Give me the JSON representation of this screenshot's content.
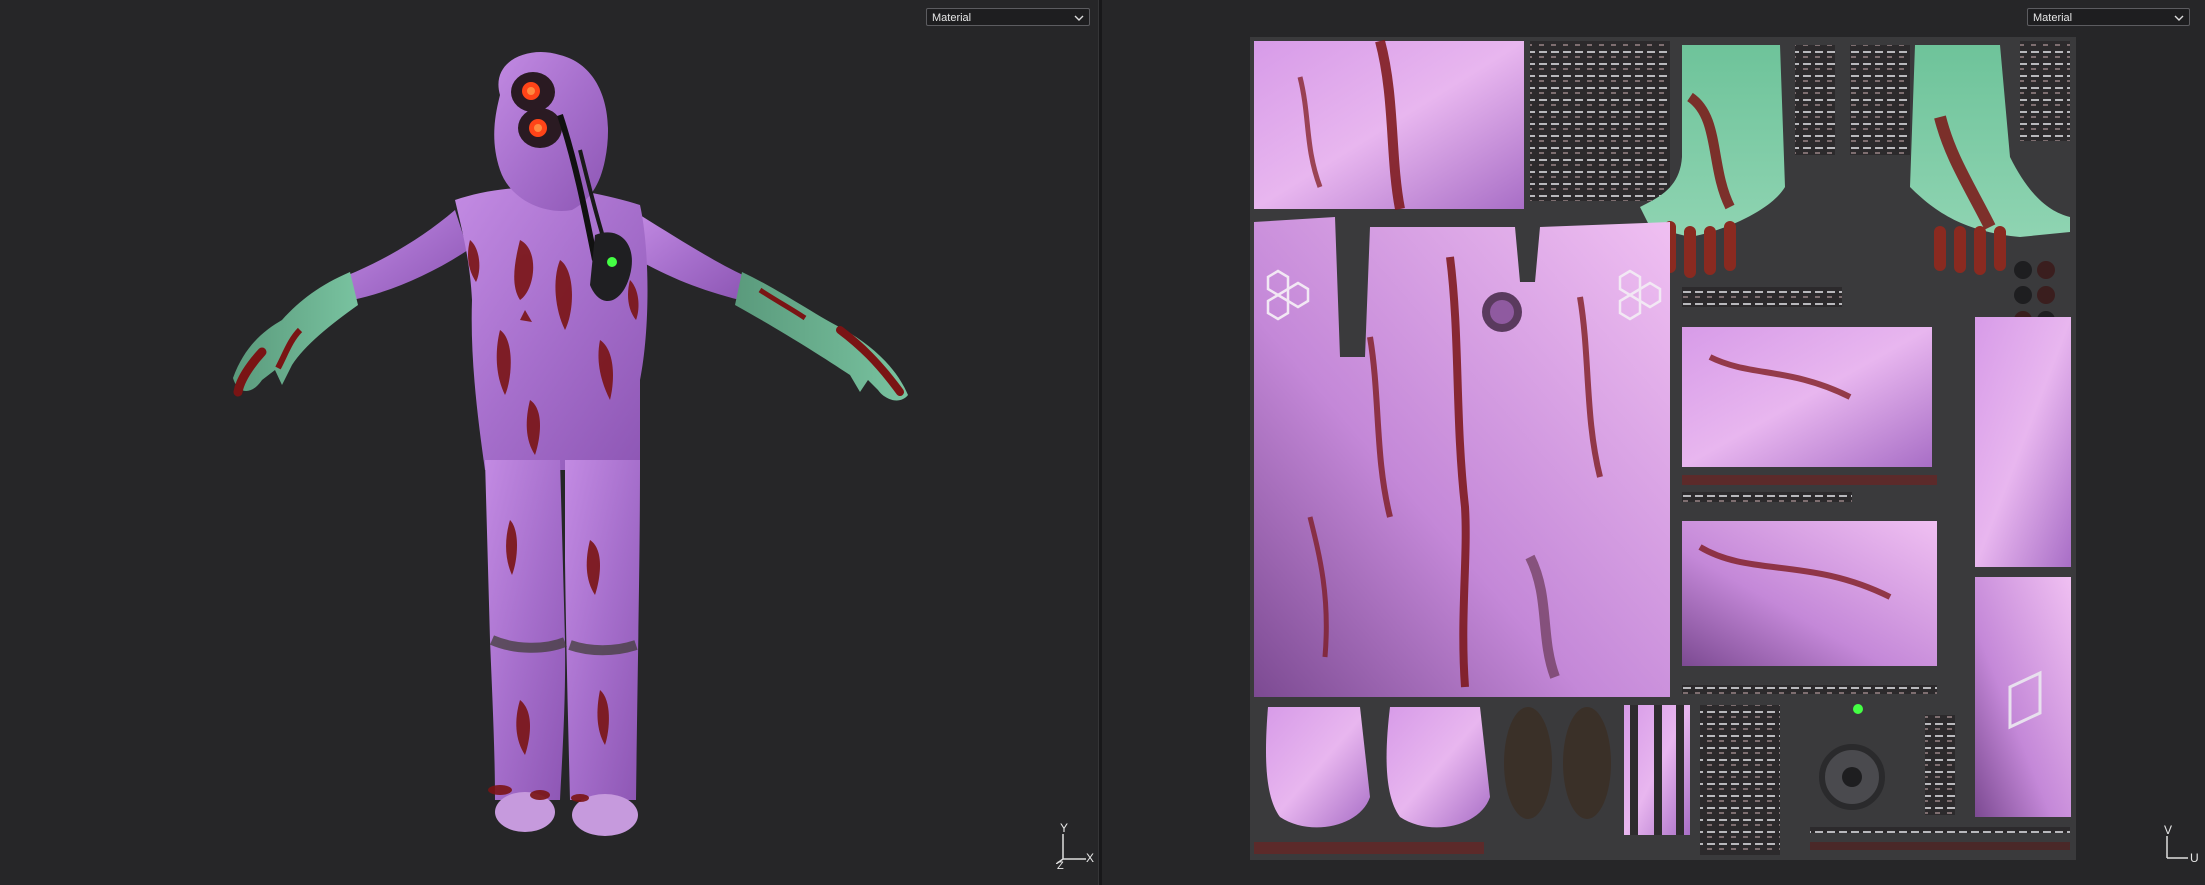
{
  "viewport_3d": {
    "mode_label": "Material",
    "axes": {
      "y": "Y",
      "x": "X",
      "z": "Z"
    }
  },
  "viewport_uv": {
    "mode_label": "Material",
    "axes": {
      "v": "V",
      "u": "U"
    }
  },
  "colors": {
    "suit": "#b57ad8",
    "glove": "#6fb896",
    "blood": "#7a1414",
    "eye_lens": "#ff4418",
    "indicator": "#44ff44"
  }
}
